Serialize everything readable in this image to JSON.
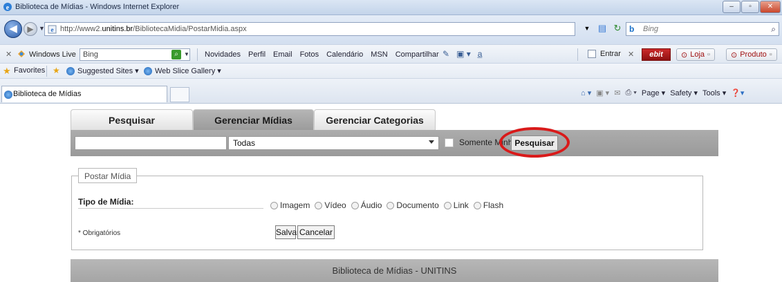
{
  "window": {
    "title": "Biblioteca de Mídias - Windows Internet Explorer"
  },
  "address": {
    "url_prefix": "http://www2.",
    "url_domain": "unitins.br",
    "url_path": "/BibliotecaMidia/PostarMidia.aspx",
    "search_placeholder": "Bing"
  },
  "livebar": {
    "label": "Windows Live",
    "search_value": "Bing",
    "links": [
      "Novidades",
      "Perfil",
      "Email",
      "Fotos",
      "Calendário",
      "MSN",
      "Compartilhar"
    ],
    "signin": "Entrar",
    "ebit": "ebit",
    "loja": "Loja",
    "produto": "Produto"
  },
  "favorites": {
    "label": "Favorites",
    "suggested": "Suggested Sites ▾",
    "webslice": "Web Slice Gallery ▾"
  },
  "tab": {
    "title": "Biblioteca de Mídias"
  },
  "cmdbar": {
    "page": "Page ▾",
    "safety": "Safety ▾",
    "tools": "Tools ▾"
  },
  "content": {
    "tabs": [
      "Pesquisar",
      "Gerenciar Mídias",
      "Gerenciar Categorias"
    ],
    "active_tab": "Gerenciar Mídias",
    "search_value": "",
    "category_select": "Todas",
    "only_mine_label": "Somente Minha",
    "search_button": "Pesquisar",
    "legend": "Postar Mídia",
    "media_type_label": "Tipo de Mídia:",
    "media_types": [
      "Imagem",
      "Vídeo",
      "Áudio",
      "Documento",
      "Link",
      "Flash"
    ],
    "required_note": "* Obrigatórios",
    "save_button": "Salvar",
    "cancel_button": "Cancelar",
    "footer": "Biblioteca de Mídias - UNITINS"
  },
  "colors": {
    "highlight_circle": "#d91a1a",
    "grey_bar": "#a3a3a3"
  }
}
